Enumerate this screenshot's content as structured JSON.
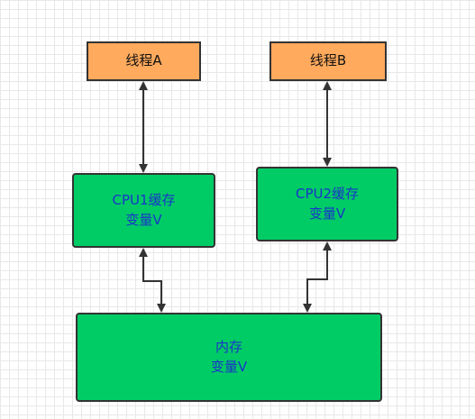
{
  "nodes": {
    "thread_a": {
      "label": "线程A"
    },
    "thread_b": {
      "label": "线程B"
    },
    "cpu1_cache": {
      "line1": "CPU1缓存",
      "line2": "变量V"
    },
    "cpu2_cache": {
      "line1": "CPU2缓存",
      "line2": "变量V"
    },
    "memory": {
      "line1": "内存",
      "line2": "变量V"
    }
  },
  "colors": {
    "thread_fill": "#ffaa5c",
    "cache_fill": "#00cc66",
    "cache_text": "#1a35c8",
    "stroke": "#333333"
  }
}
